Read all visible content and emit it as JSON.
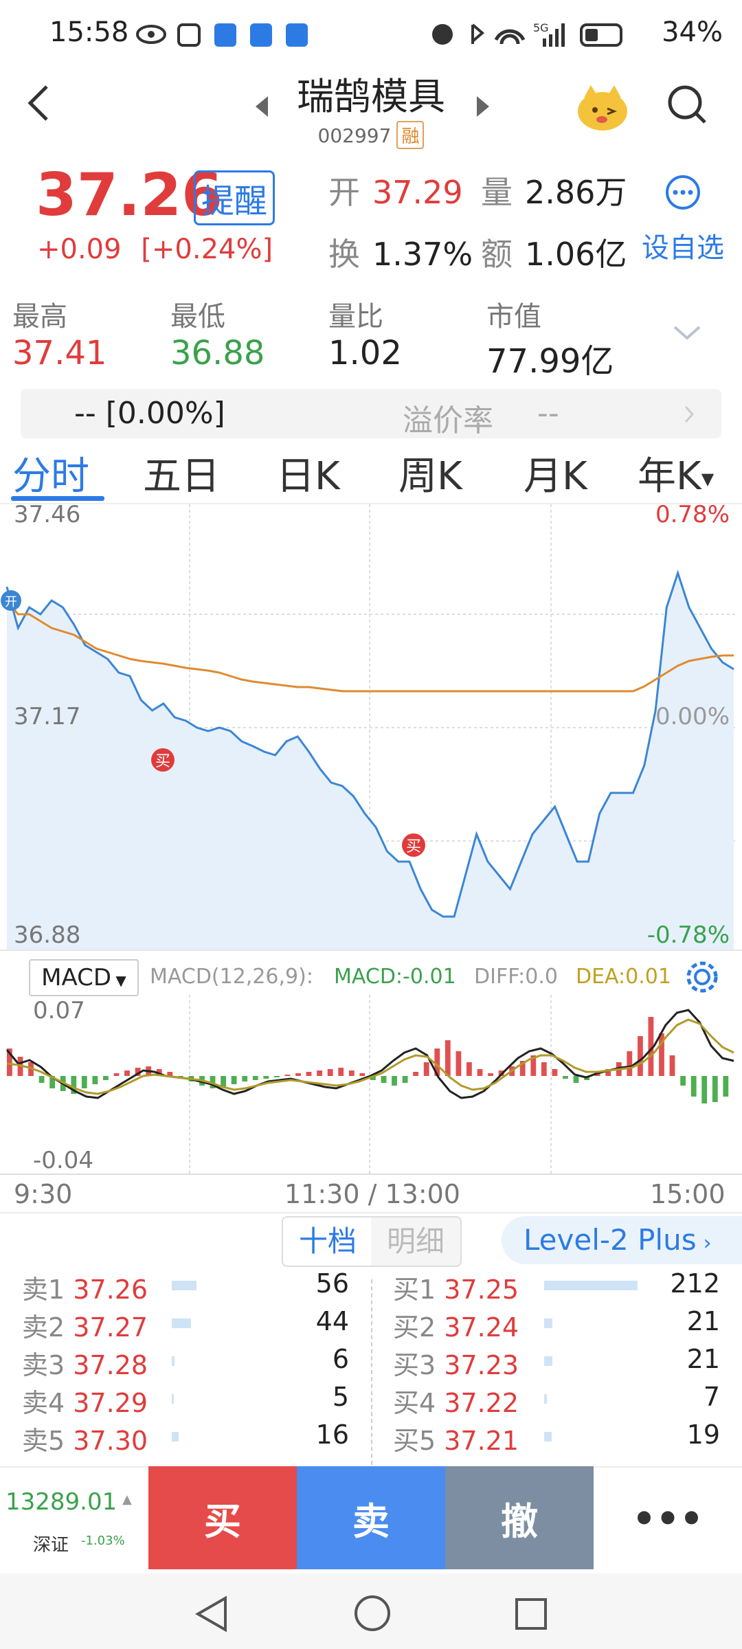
{
  "status_bar": {
    "time": "15:58",
    "battery": "34%",
    "network": "5G"
  },
  "header": {
    "title": "瑞鹄模具",
    "code": "002997",
    "tag": "融"
  },
  "quote": {
    "price": "37.26",
    "remind_label": "提醒",
    "change": "+0.09",
    "change_pct": "[+0.24%]",
    "open_label": "开",
    "open": "37.29",
    "volume_label": "量",
    "volume": "2.86万",
    "turnover_label": "换",
    "turnover": "1.37%",
    "amount_label": "额",
    "amount": "1.06亿",
    "add_watch_label": "设自选"
  },
  "stats": [
    {
      "label": "最高",
      "value": "37.41",
      "color": "red"
    },
    {
      "label": "最低",
      "value": "36.88",
      "color": "green"
    },
    {
      "label": "量比",
      "value": "1.02",
      "color": "black"
    },
    {
      "label": "市值",
      "value": "77.99亿",
      "color": "black"
    }
  ],
  "premium_bar": {
    "left": "--  [0.00%]",
    "label": "溢价率",
    "value": "--"
  },
  "tabs": [
    "分时",
    "五日",
    "日K",
    "周K",
    "月K",
    "年K"
  ],
  "intraday": {
    "y_top": "37.46",
    "y_mid": "37.17",
    "y_bottom": "36.88",
    "pct_top": "0.78%",
    "pct_mid": "0.00%",
    "pct_bottom": "-0.78%",
    "buy_marker": "买",
    "start_marker": "开"
  },
  "macd": {
    "selector": "MACD",
    "params": "MACD(12,26,9):",
    "macd": "MACD:-0.01",
    "diff": "DIFF:0.0",
    "dea": "DEA:0.01",
    "y_top": "0.07",
    "y_bottom": "-0.04"
  },
  "time_axis": {
    "start": "9:30",
    "mid": "11:30 / 13:00",
    "end": "15:00"
  },
  "depth_tabs": {
    "ten": "十档",
    "detail": "明细",
    "level2": "Level-2 Plus"
  },
  "asks": [
    {
      "label": "卖1",
      "price": "37.26",
      "vol": "56"
    },
    {
      "label": "卖2",
      "price": "37.27",
      "vol": "44"
    },
    {
      "label": "卖3",
      "price": "37.28",
      "vol": "6"
    },
    {
      "label": "卖4",
      "price": "37.29",
      "vol": "5"
    },
    {
      "label": "卖5",
      "price": "37.30",
      "vol": "16"
    }
  ],
  "bids": [
    {
      "label": "买1",
      "price": "37.25",
      "vol": "212"
    },
    {
      "label": "买2",
      "price": "37.24",
      "vol": "21"
    },
    {
      "label": "买3",
      "price": "37.23",
      "vol": "21"
    },
    {
      "label": "买4",
      "price": "37.22",
      "vol": "7"
    },
    {
      "label": "买5",
      "price": "37.21",
      "vol": "19"
    }
  ],
  "index_box": {
    "value": "13289.01",
    "name": "深证",
    "pct": "-1.03%"
  },
  "actions": {
    "buy": "买",
    "sell": "卖",
    "cancel": "撤",
    "more": "•••"
  }
}
